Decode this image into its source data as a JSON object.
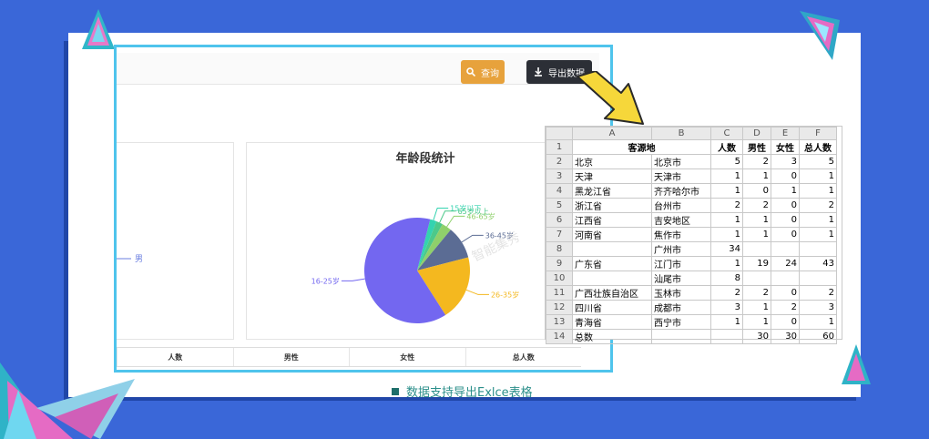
{
  "toolbar": {
    "query_label": "查询",
    "export_label": "导出数据"
  },
  "panel": {
    "left_legend": "男",
    "right_title": "年龄段统计"
  },
  "pie": {
    "labels": [
      "15岁以下",
      "65岁以上",
      "46-65岁",
      "36-45岁",
      "26-35岁",
      "16-25岁"
    ],
    "fractions": [
      0.02,
      0.02,
      0.03,
      0.1,
      0.2,
      0.63
    ],
    "colors": [
      "#34d3b0",
      "#4cc98a",
      "#8fd06b",
      "#5b6c94",
      "#f4b81f",
      "#7367f0"
    ]
  },
  "table_header": [
    "人数",
    "男性",
    "女性",
    "总人数"
  ],
  "excel": {
    "columns": [
      "A",
      "B",
      "C",
      "D",
      "E",
      "F"
    ],
    "rows": [
      {
        "n": "1",
        "cells": [
          "客源地",
          "",
          "人数",
          "男性",
          "女性",
          "总人数"
        ]
      },
      {
        "n": "2",
        "cells": [
          "北京",
          "北京市",
          "5",
          "2",
          "3",
          "5"
        ]
      },
      {
        "n": "3",
        "cells": [
          "天津",
          "天津市",
          "1",
          "1",
          "0",
          "1"
        ]
      },
      {
        "n": "4",
        "cells": [
          "黑龙江省",
          "齐齐哈尔市",
          "1",
          "0",
          "1",
          "1"
        ]
      },
      {
        "n": "5",
        "cells": [
          "浙江省",
          "台州市",
          "2",
          "2",
          "0",
          "2"
        ]
      },
      {
        "n": "6",
        "cells": [
          "江西省",
          "吉安地区",
          "1",
          "1",
          "0",
          "1"
        ]
      },
      {
        "n": "7",
        "cells": [
          "河南省",
          "焦作市",
          "1",
          "1",
          "0",
          "1"
        ]
      },
      {
        "n": "8",
        "cells": [
          "",
          "广州市",
          "34",
          "",
          "",
          ""
        ]
      },
      {
        "n": "9",
        "cells": [
          "广东省",
          "江门市",
          "1",
          "19",
          "24",
          "43"
        ]
      },
      {
        "n": "10",
        "cells": [
          "",
          "汕尾市",
          "8",
          "",
          "",
          ""
        ]
      },
      {
        "n": "11",
        "cells": [
          "广西壮族自治区",
          "玉林市",
          "2",
          "2",
          "0",
          "2"
        ]
      },
      {
        "n": "12",
        "cells": [
          "四川省",
          "成都市",
          "3",
          "1",
          "2",
          "3"
        ]
      },
      {
        "n": "13",
        "cells": [
          "青海省",
          "西宁市",
          "1",
          "1",
          "0",
          "1"
        ]
      },
      {
        "n": "14",
        "cells": [
          "总数",
          "",
          "",
          "30",
          "30",
          "60"
        ]
      }
    ]
  },
  "caption": "数据支持导出Exlce表格",
  "watermark": "智能集秀"
}
